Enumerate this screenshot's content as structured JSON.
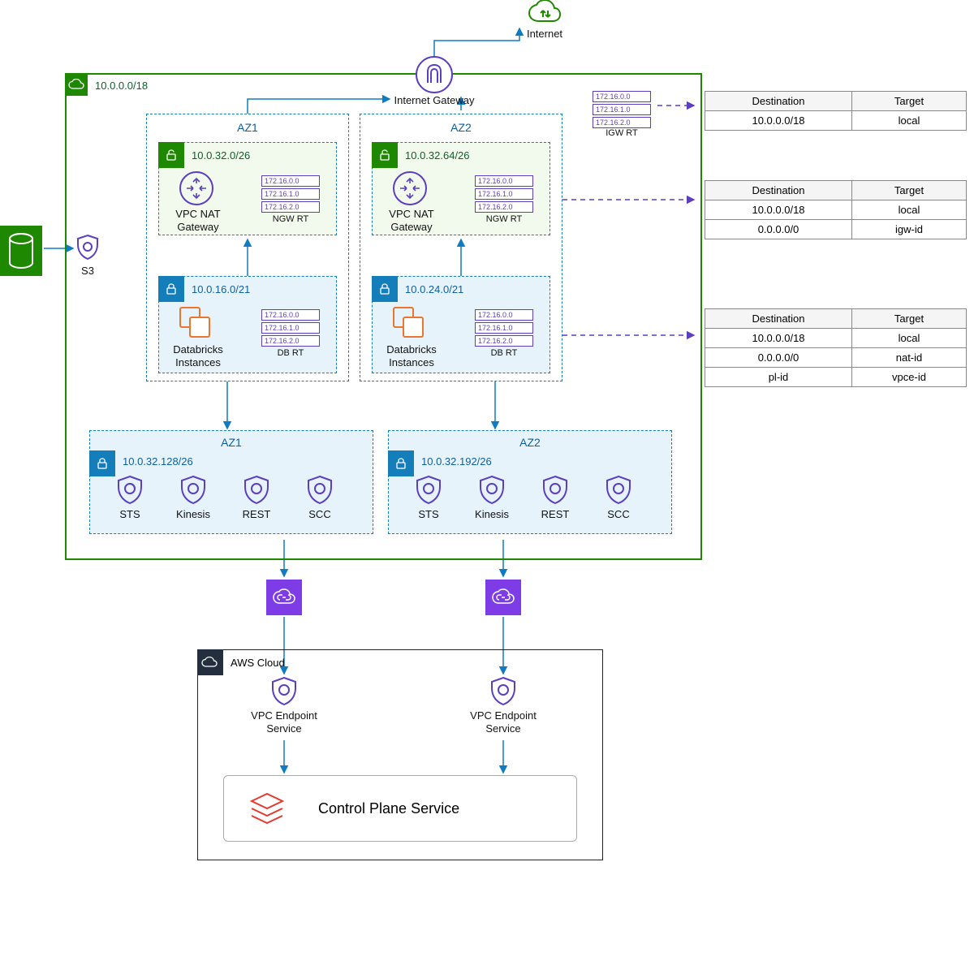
{
  "internet": {
    "label": "Internet"
  },
  "igw": {
    "label": "Internet Gateway"
  },
  "vpc": {
    "cidr": "10.0.0.0/18"
  },
  "s3": {
    "label": "S3"
  },
  "az1": {
    "header": "AZ1",
    "nat": {
      "cidr": "10.0.32.0/26",
      "label": "VPC NAT\nGateway",
      "rt": [
        "172.16.0.0",
        "172.16.1.0",
        "172.16.2.0"
      ],
      "rt_label": "NGW RT"
    },
    "db": {
      "cidr": "10.0.16.0/21",
      "label": "Databricks\nInstances",
      "rt": [
        "172.16.0.0",
        "172.16.1.0",
        "172.16.2.0"
      ],
      "rt_label": "DB RT"
    },
    "ep": {
      "cidr": "10.0.32.128/26",
      "services": [
        "STS",
        "Kinesis",
        "REST",
        "SCC"
      ]
    }
  },
  "az2": {
    "header": "AZ2",
    "nat": {
      "cidr": "10.0.32.64/26",
      "label": "VPC NAT\nGateway",
      "rt": [
        "172.16.0.0",
        "172.16.1.0",
        "172.16.2.0"
      ],
      "rt_label": "NGW RT"
    },
    "db": {
      "cidr": "10.0.24.0/21",
      "label": "Databricks\nInstances",
      "rt": [
        "172.16.0.0",
        "172.16.1.0",
        "172.16.2.0"
      ],
      "rt_label": "DB RT"
    },
    "ep": {
      "cidr": "10.0.32.192/26",
      "services": [
        "STS",
        "Kinesis",
        "REST",
        "SCC"
      ]
    }
  },
  "igw_rt": {
    "label": "IGW RT",
    "entries": [
      "172.16.0.0",
      "172.16.1.0",
      "172.16.2.0"
    ]
  },
  "tables": {
    "headers": {
      "dest": "Destination",
      "target": "Target"
    },
    "igw": [
      {
        "dest": "10.0.0.0/18",
        "target": "local"
      }
    ],
    "ngw": [
      {
        "dest": "10.0.0.0/18",
        "target": "local"
      },
      {
        "dest": "0.0.0.0/0",
        "target": "igw-id"
      }
    ],
    "db": [
      {
        "dest": "10.0.0.0/18",
        "target": "local"
      },
      {
        "dest": "0.0.0.0/0",
        "target": "nat-id"
      },
      {
        "dest": "pl-id",
        "target": "vpce-id"
      }
    ]
  },
  "aws": {
    "label": "AWS Cloud"
  },
  "vpce": {
    "label": "VPC Endpoint\nService"
  },
  "cps": {
    "label": "Control Plane Service"
  },
  "colors": {
    "blue": "#147EBA",
    "purple": "#5B3FBF",
    "green": "#1E8900",
    "orange": "#E8762E",
    "red": "#E23B2E"
  }
}
